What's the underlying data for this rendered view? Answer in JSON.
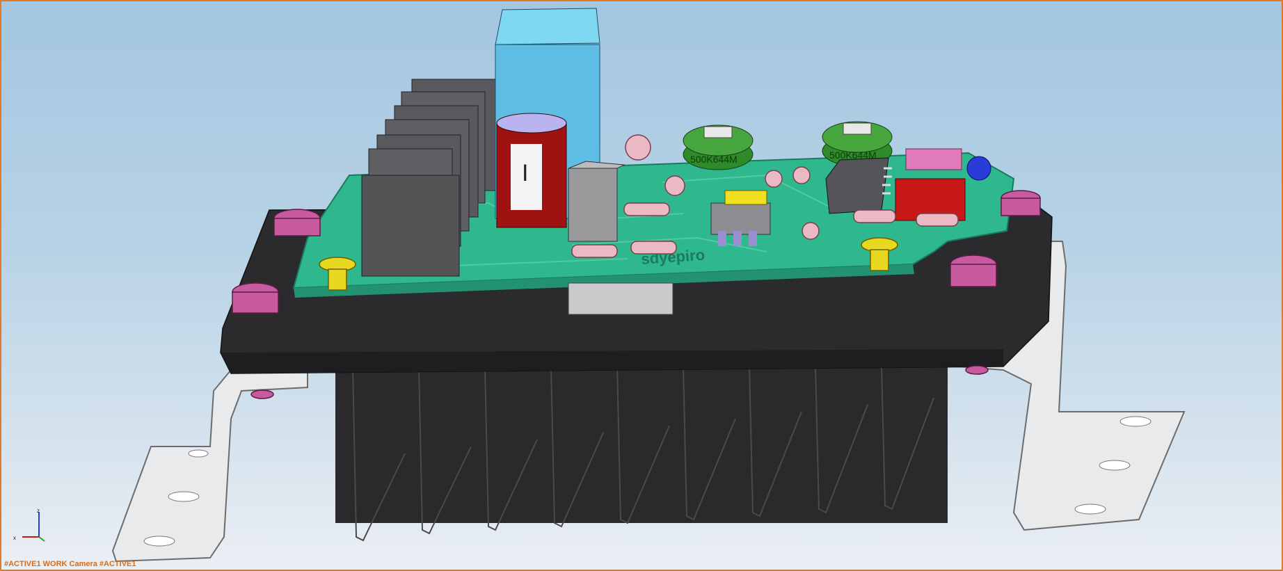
{
  "viewport": {
    "status_text": "#ACTIVE1 WORK Camera #ACTIVE1",
    "triad": {
      "z_label": "z",
      "x_label": "x"
    }
  },
  "model": {
    "potentiometer_1_label": "500K644M",
    "potentiometer_2_label": "500K644M",
    "capacitor_mark": "I"
  },
  "colors": {
    "viewport_border": "#e07a2a",
    "status_text": "#e06a10",
    "pcb": "#2fb88e",
    "heatsink": "#2b2b2d",
    "bracket": "#e9eaec",
    "screw_pink": "#c85aa0",
    "screw_yellow": "#e8d820",
    "capacitor_red": "#a01212",
    "relay_blue": "#5fbde6"
  }
}
